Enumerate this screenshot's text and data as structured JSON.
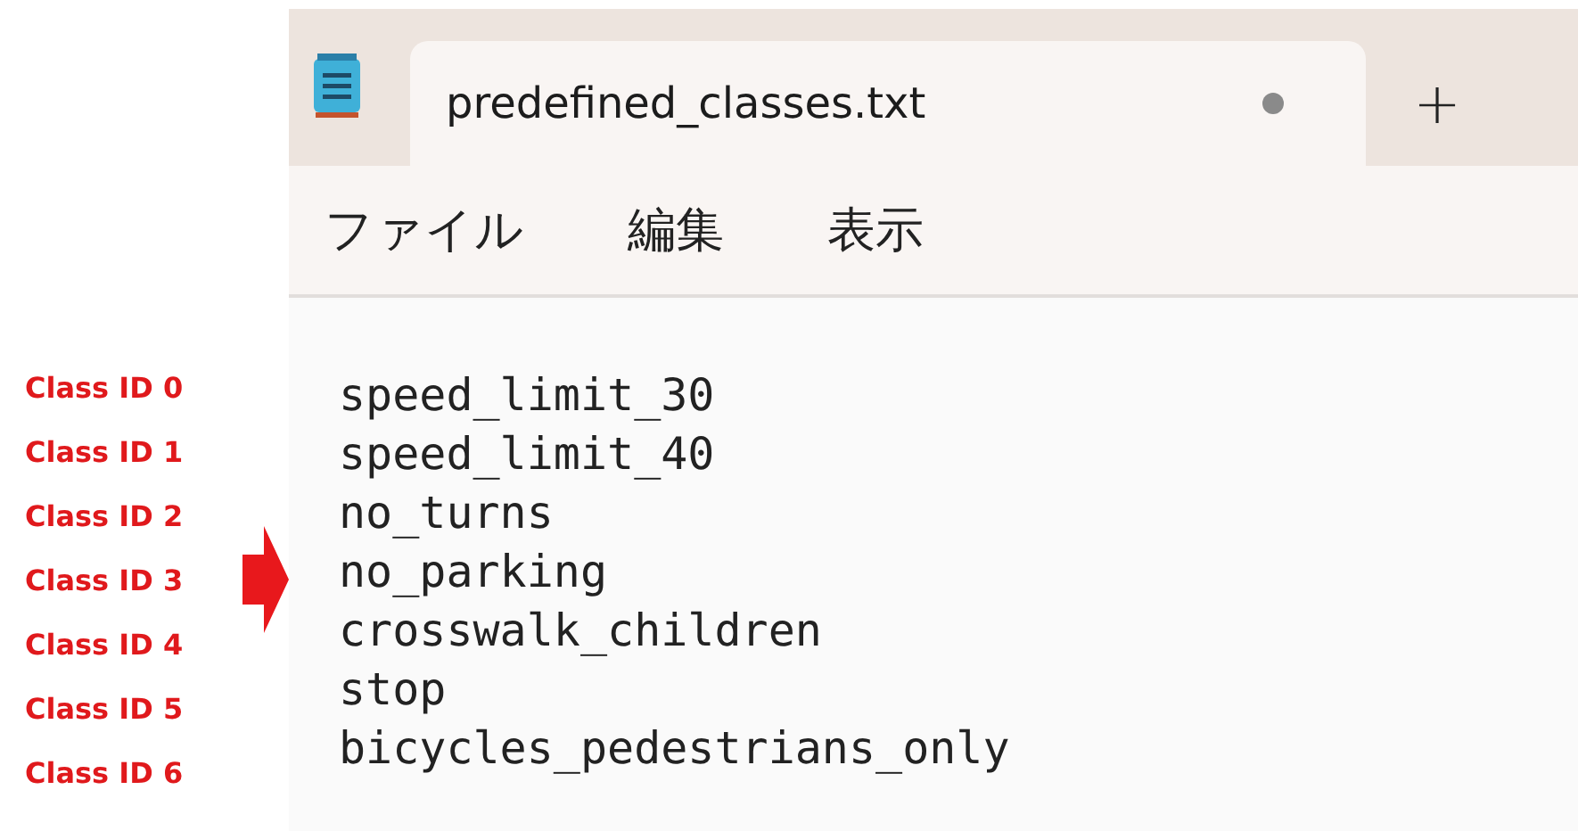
{
  "annotations": [
    {
      "label": "Class ID 0",
      "pointed": false
    },
    {
      "label": "Class ID 1",
      "pointed": false
    },
    {
      "label": "Class ID 2",
      "pointed": false
    },
    {
      "label": "Class ID 3",
      "pointed": true
    },
    {
      "label": "Class ID 4",
      "pointed": false
    },
    {
      "label": "Class ID 5",
      "pointed": false
    },
    {
      "label": "Class ID 6",
      "pointed": false
    }
  ],
  "window": {
    "tabs": [
      {
        "title": "predefined_classes.txt",
        "selected": true,
        "modified": true
      }
    ],
    "new_tab": "+"
  },
  "menu": [
    "ファイル",
    "編集",
    "表示"
  ],
  "editor": {
    "lines": [
      "speed_limit_30",
      "speed_limit_40",
      "no_turns",
      "no_parking",
      "crosswalk_children",
      "stop",
      "bicycles_pedestrians_only"
    ]
  }
}
